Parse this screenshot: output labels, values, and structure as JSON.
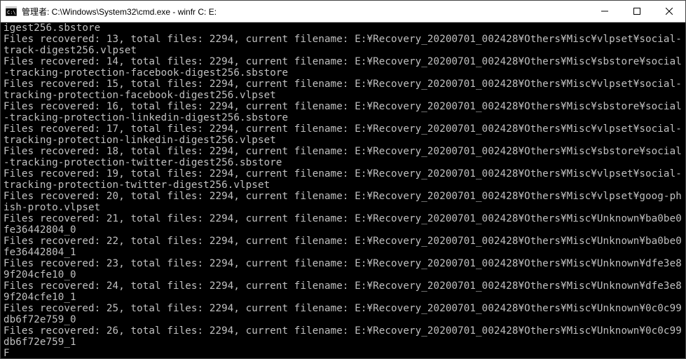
{
  "window": {
    "title": "管理者: C:\\Windows\\System32\\cmd.exe - winfr  C: E:"
  },
  "terminal": {
    "lines": [
      "igest256.sbstore",
      "Files recovered: 13, total files: 2294, current filename: E:\\Recovery_20200701_002428\\Others\\Misc\\vlpset\\social-track-digest256.vlpset",
      "Files recovered: 14, total files: 2294, current filename: E:\\Recovery_20200701_002428\\Others\\Misc\\sbstore\\social-tracking-protection-facebook-digest256.sbstore",
      "Files recovered: 15, total files: 2294, current filename: E:\\Recovery_20200701_002428\\Others\\Misc\\vlpset\\social-tracking-protection-facebook-digest256.vlpset",
      "Files recovered: 16, total files: 2294, current filename: E:\\Recovery_20200701_002428\\Others\\Misc\\sbstore\\social-tracking-protection-linkedin-digest256.sbstore",
      "Files recovered: 17, total files: 2294, current filename: E:\\Recovery_20200701_002428\\Others\\Misc\\vlpset\\social-tracking-protection-linkedin-digest256.vlpset",
      "Files recovered: 18, total files: 2294, current filename: E:\\Recovery_20200701_002428\\Others\\Misc\\sbstore\\social-tracking-protection-twitter-digest256.sbstore",
      "Files recovered: 19, total files: 2294, current filename: E:\\Recovery_20200701_002428\\Others\\Misc\\vlpset\\social-tracking-protection-twitter-digest256.vlpset",
      "Files recovered: 20, total files: 2294, current filename: E:\\Recovery_20200701_002428\\Others\\Misc\\vlpset\\goog-phish-proto.vlpset",
      "Files recovered: 21, total files: 2294, current filename: E:\\Recovery_20200701_002428\\Others\\Misc\\Unknown\\ba0be0fe36442804_0",
      "Files recovered: 22, total files: 2294, current filename: E:\\Recovery_20200701_002428\\Others\\Misc\\Unknown\\ba0be0fe36442804_1",
      "Files recovered: 23, total files: 2294, current filename: E:\\Recovery_20200701_002428\\Others\\Misc\\Unknown\\dfe3e89f204cfe10_0",
      "Files recovered: 24, total files: 2294, current filename: E:\\Recovery_20200701_002428\\Others\\Misc\\Unknown\\dfe3e89f204cfe10_1",
      "Files recovered: 25, total files: 2294, current filename: E:\\Recovery_20200701_002428\\Others\\Misc\\Unknown\\0c0c99db6f72e759_0",
      "Files recovered: 26, total files: 2294, current filename: E:\\Recovery_20200701_002428\\Others\\Misc\\Unknown\\0c0c99db6f72e759_1",
      "F"
    ]
  }
}
